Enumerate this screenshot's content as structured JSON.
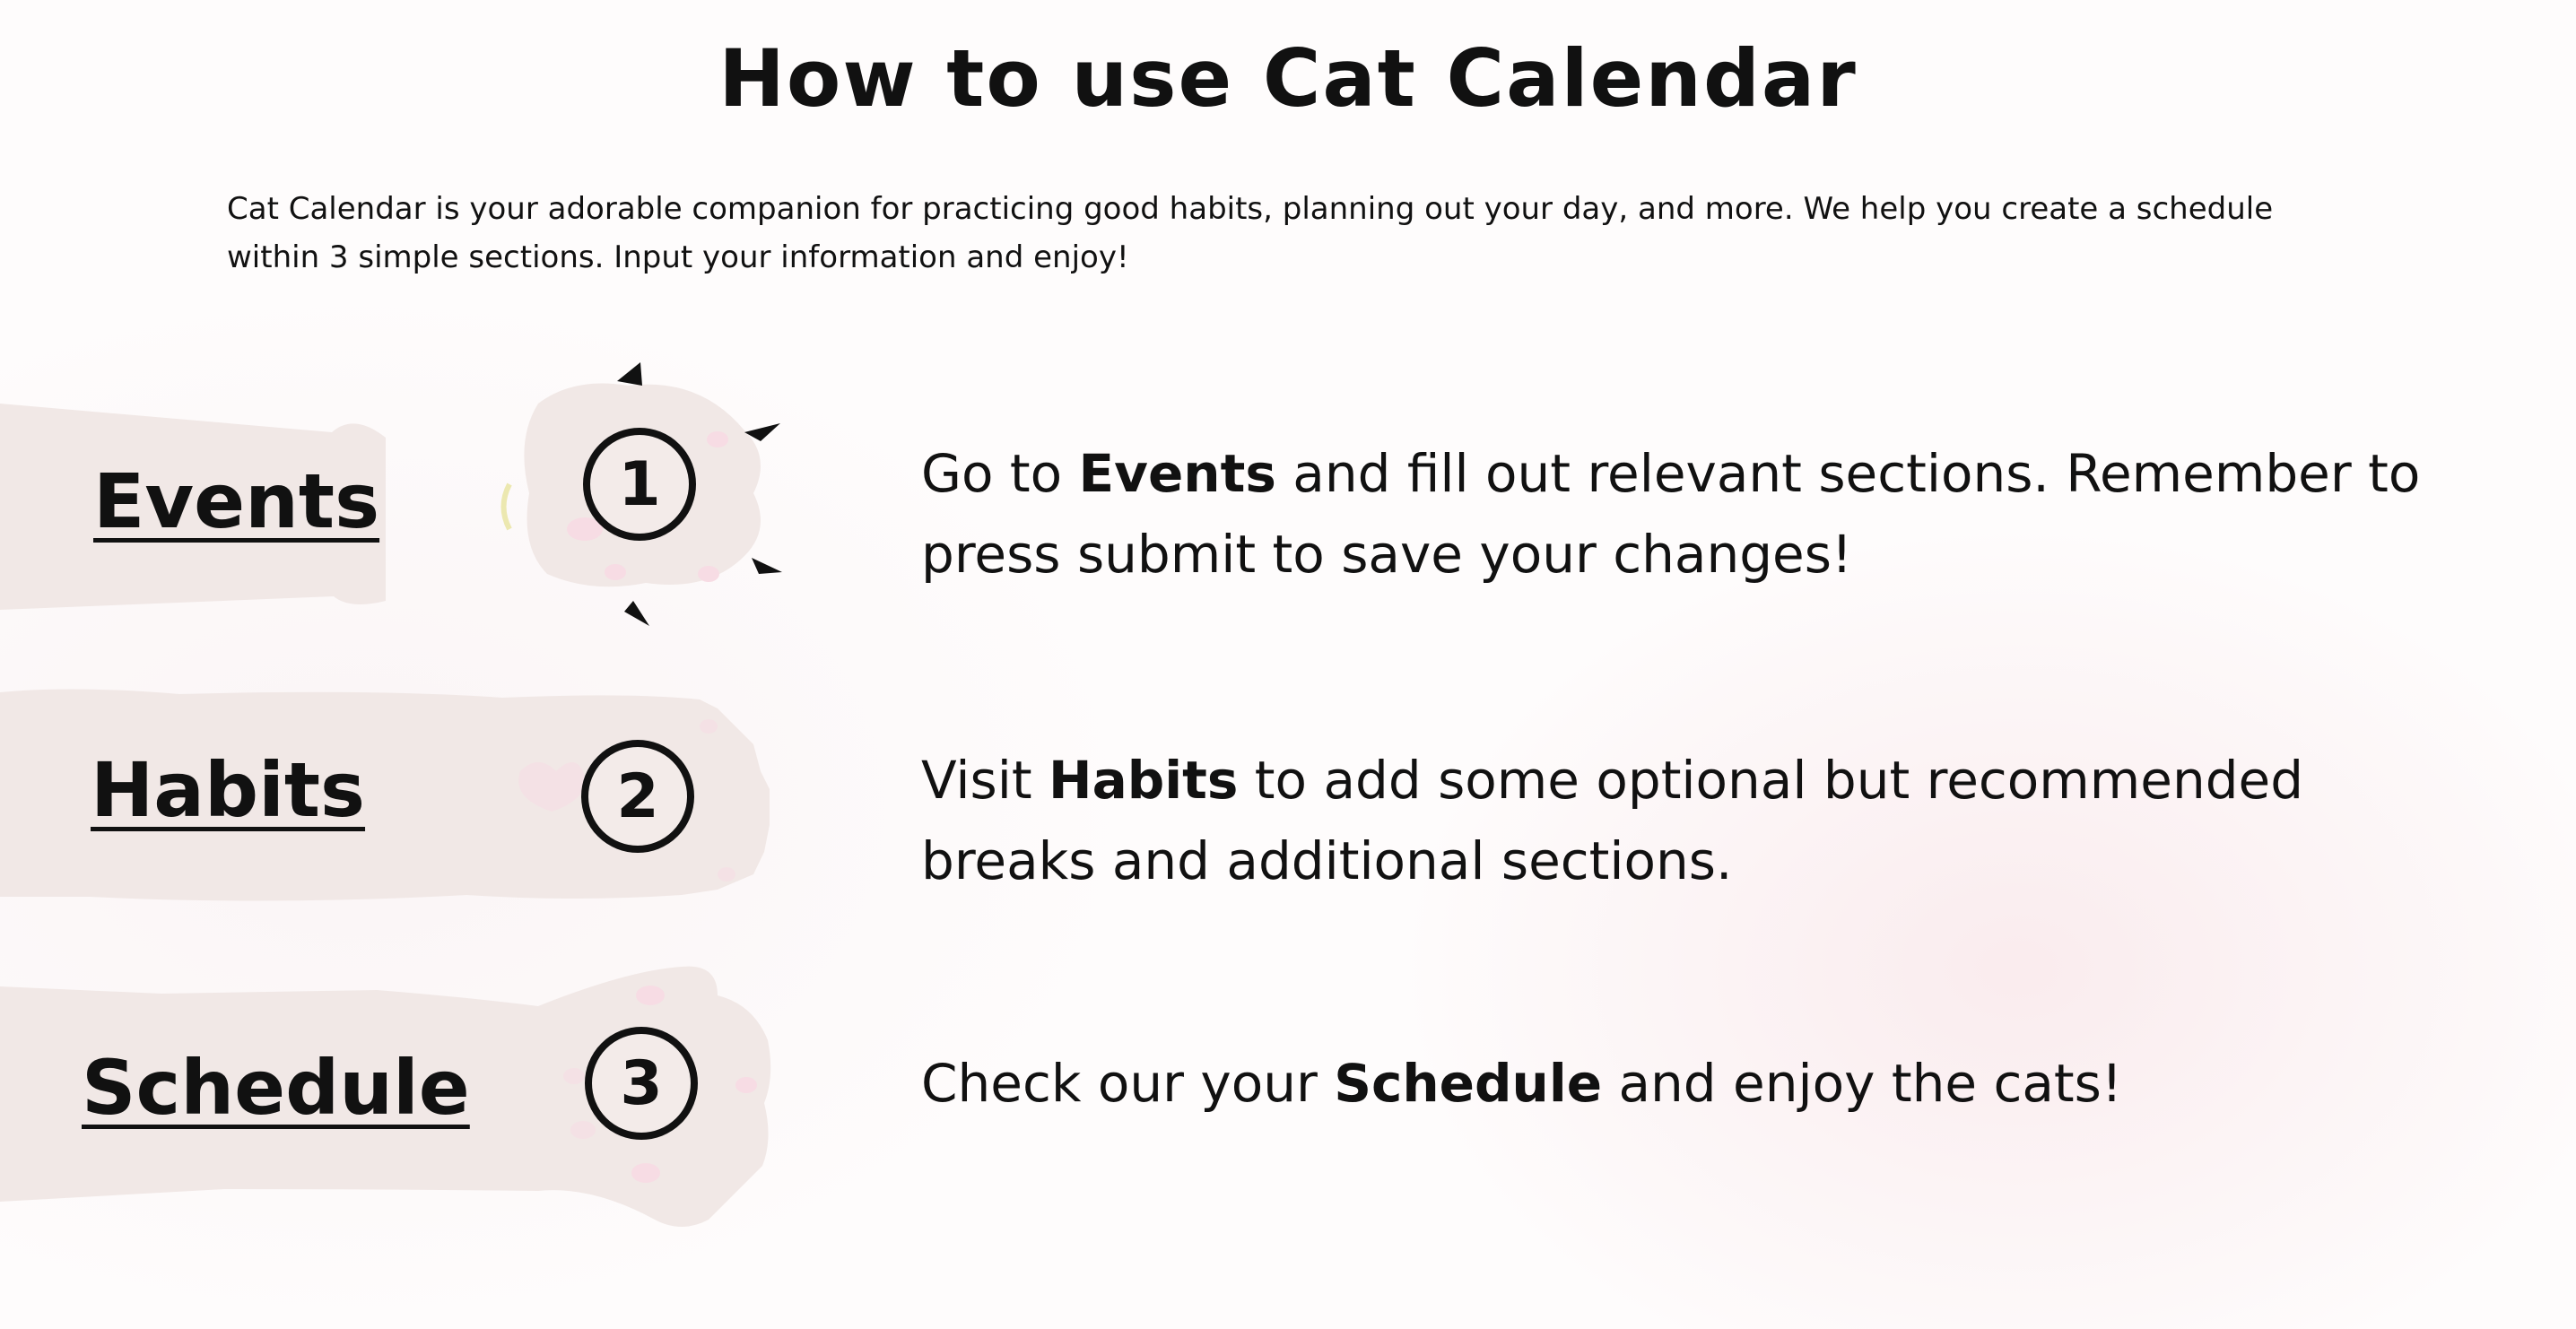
{
  "page": {
    "title": "How to use Cat Calendar",
    "intro": "Cat Calendar is your adorable companion for practicing good habits, planning out your day, and more. We help you create a schedule within 3 simple sections. Input your information and enjoy!"
  },
  "steps": [
    {
      "link_label": "Events",
      "number": "1",
      "desc_before": "Go to ",
      "desc_bold": "Events",
      "desc_after": " and fill out relevant sections. Remember to press submit to save your changes!"
    },
    {
      "link_label": "Habits",
      "number": "2",
      "desc_before": "Visit ",
      "desc_bold": "Habits",
      "desc_after": " to add some optional but recommended breaks and additional sections."
    },
    {
      "link_label": "Schedule",
      "number": "3",
      "desc_before": "Check our your ",
      "desc_bold": "Schedule",
      "desc_after": " and enjoy the cats!"
    }
  ],
  "colors": {
    "text": "#111111",
    "paw_fur": "#f1e8e6",
    "paw_pad": "#f7dce4",
    "claws": "#111111",
    "background": "#fefcfc"
  },
  "icons": {
    "decoration": "cat-paw-illustration"
  }
}
